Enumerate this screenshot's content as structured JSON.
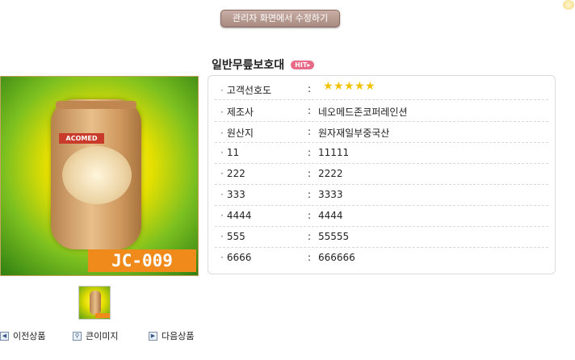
{
  "admin": {
    "edit_button_label": "관리자 화면에서 수정하기"
  },
  "product": {
    "title": "일반무릎보호대",
    "badge": "HIT",
    "image": {
      "brand_text": "ACOMED",
      "model_text": "JC-009"
    },
    "details": [
      {
        "label": "고객선호도",
        "type": "rating",
        "rating": 5,
        "max": 5
      },
      {
        "label": "제조사",
        "value": "네오메드존코퍼레인션"
      },
      {
        "label": "원산지",
        "value": "원자재일부중국산"
      },
      {
        "label": "11",
        "value": "11111"
      },
      {
        "label": "222",
        "value": "2222"
      },
      {
        "label": "333",
        "value": "3333"
      },
      {
        "label": "4444",
        "value": "4444"
      },
      {
        "label": "555",
        "value": "55555"
      },
      {
        "label": "6666",
        "value": "666666"
      }
    ],
    "separator": ":"
  },
  "navigation": {
    "prev_label": "이전상품",
    "zoom_label": "큰이미지",
    "next_label": "다음상품"
  },
  "icons": {
    "prev": "arrow-left-icon",
    "zoom": "magnifier-icon",
    "next": "arrow-right-icon",
    "star": "star-icon"
  },
  "colors": {
    "star": "#f2c200",
    "badge": "#e86a86",
    "model_box": "#f08a1a"
  }
}
